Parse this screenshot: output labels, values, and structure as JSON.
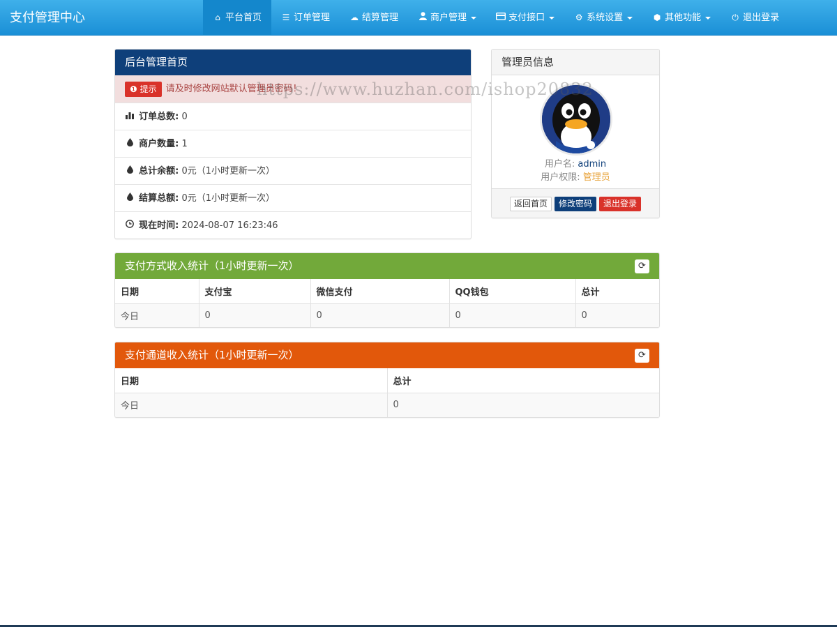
{
  "brand": "支付管理中心",
  "nav": [
    {
      "icon": "home-icon",
      "glyph": "⌂",
      "label": "平台首页",
      "active": true,
      "caret": false
    },
    {
      "icon": "list-icon",
      "glyph": "☰",
      "label": "订单管理",
      "caret": false
    },
    {
      "icon": "cloud-icon",
      "glyph": "☁",
      "label": "结算管理",
      "caret": false
    },
    {
      "icon": "user-icon",
      "glyph": "👤",
      "label": "商户管理",
      "caret": true
    },
    {
      "icon": "credit-card-icon",
      "glyph": "▭",
      "label": "支付接口",
      "caret": true
    },
    {
      "icon": "gear-icon",
      "glyph": "⚙",
      "label": "系统设置",
      "caret": true
    },
    {
      "icon": "cube-icon",
      "glyph": "⬢",
      "label": "其他功能",
      "caret": true
    },
    {
      "icon": "power-icon",
      "glyph": "⏻",
      "label": "退出登录",
      "caret": false
    }
  ],
  "home_panel": {
    "title": "后台管理首页",
    "alert_badge": "提示",
    "alert_text": "请及时修改网站默认管理员密码！",
    "rows": [
      {
        "icon": "bar-chart-icon",
        "label": "订单总数:",
        "value": "0"
      },
      {
        "icon": "drop-icon",
        "label": "商户数量:",
        "value": "1"
      },
      {
        "icon": "drop-icon",
        "label": "总计余额:",
        "value": "0元（1小时更新一次）"
      },
      {
        "icon": "drop-icon",
        "label": "结算总额:",
        "value": "0元（1小时更新一次）"
      },
      {
        "icon": "clock-icon",
        "label": "现在时间:",
        "value": "2024-08-07 16:23:46"
      }
    ]
  },
  "admin_panel": {
    "title": "管理员信息",
    "username_label": "用户名:",
    "username": "admin",
    "role_label": "用户权限:",
    "role": "管理员",
    "buttons": {
      "home": "返回首页",
      "password": "修改密码",
      "logout": "退出登录"
    }
  },
  "pay_method_panel": {
    "title": "支付方式收入统计（1小时更新一次）",
    "headers": [
      "日期",
      "支付宝",
      "微信支付",
      "QQ钱包",
      "总计"
    ],
    "row": [
      "今日",
      "0",
      "0",
      "0",
      "0"
    ]
  },
  "pay_channel_panel": {
    "title": "支付通道收入统计（1小时更新一次）",
    "headers": [
      "日期",
      "总计"
    ],
    "row": [
      "今日",
      "0"
    ]
  },
  "watermark": "https://www.huzhan.com/ishop20832",
  "colors": {
    "navbar": "#1a8fd6",
    "panel_blue": "#0e3f7a",
    "panel_green": "#72a93a",
    "panel_orange": "#e2580b",
    "danger": "#d9322a",
    "username": "#0e3f7a",
    "role": "#e8a33a"
  }
}
